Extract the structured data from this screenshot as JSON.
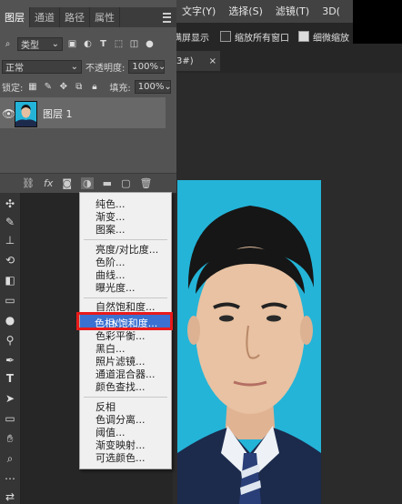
{
  "app": {
    "menu": [
      "文字(Y)",
      "选择(S)",
      "滤镜(T)",
      "3D("
    ],
    "options": {
      "full_display": "满屏显示",
      "zoom_all_windows": "缩放所有窗口",
      "scrubby_zoom": "细微缩放"
    },
    "doc_tab": {
      "label": "3#)",
      "close": "×"
    }
  },
  "layers_panel": {
    "tabs": [
      "图层",
      "通道",
      "路径",
      "属性"
    ],
    "kind_filter": "类型",
    "blend_mode": "正常",
    "opacity_label": "不透明度:",
    "opacity_value": "100%",
    "lock_label": "锁定:",
    "fill_label": "填充:",
    "fill_value": "100%",
    "layer_name": "图层 1"
  },
  "adjustment_menu": {
    "items": [
      "纯色...",
      "渐变...",
      "图案...",
      "亮度/对比度...",
      "色阶...",
      "曲线...",
      "曝光度...",
      "自然饱和度...",
      "色相/饱和度...",
      "色彩平衡...",
      "黑白...",
      "照片滤镜...",
      "通道混合器...",
      "颜色查找...",
      "反相",
      "色调分离...",
      "阈值...",
      "渐变映射...",
      "可选颜色..."
    ],
    "highlighted_index": 8
  },
  "colors": {
    "photo_background": "#24b4d8",
    "highlight": "#3b71d0",
    "annotation_box": "#ea1a1a"
  }
}
